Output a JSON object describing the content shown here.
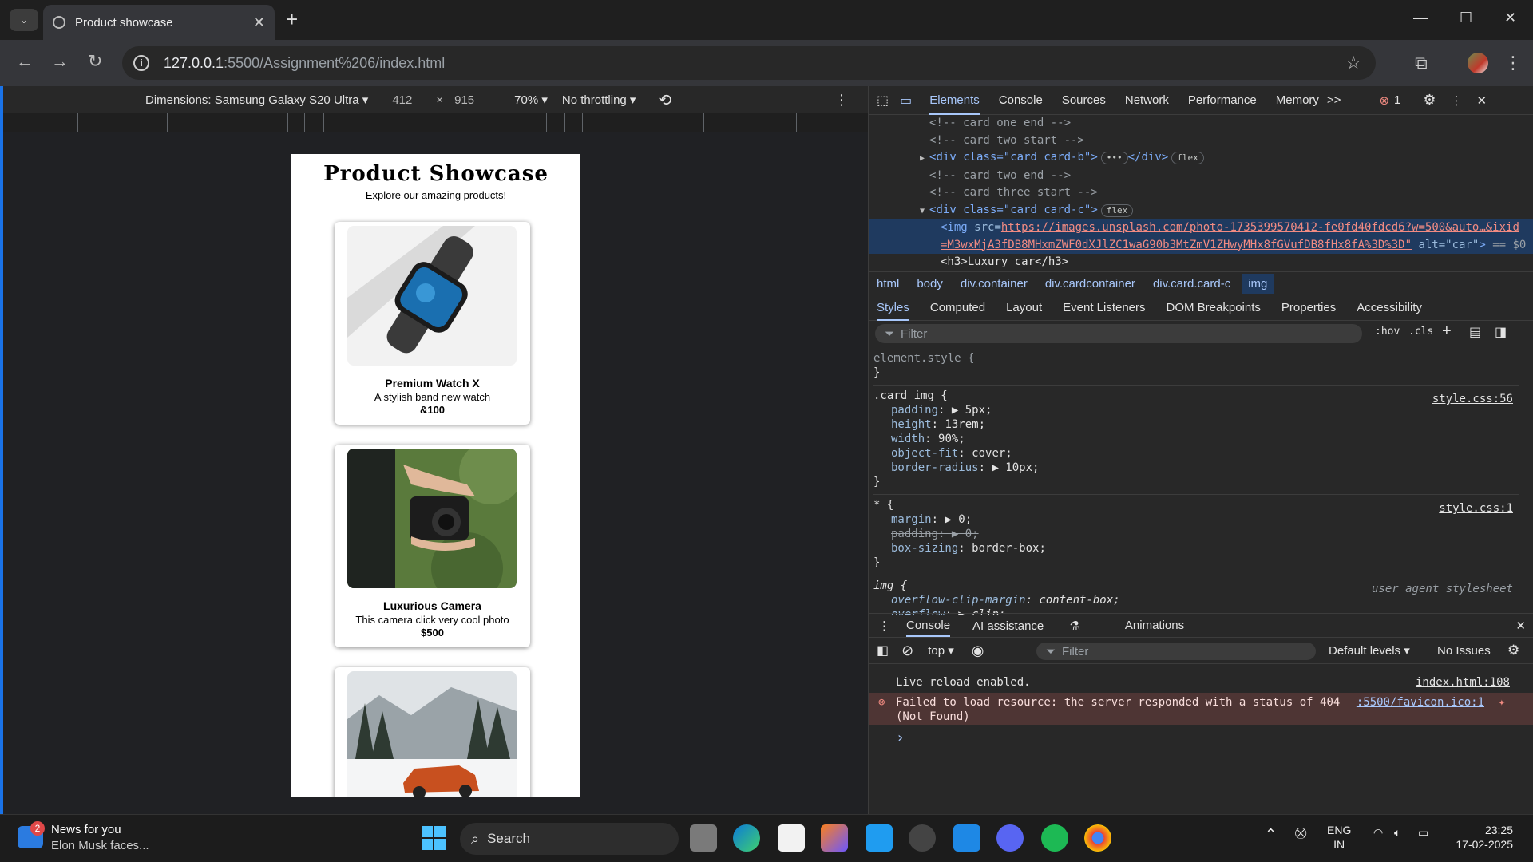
{
  "browser": {
    "tab_title": "Product showcase",
    "tab_close": "✕",
    "new_tab": "+",
    "url_host": "127.0.0.1",
    "url_rest": ":5500/Assignment%206/index.html",
    "window_min": "—",
    "window_max": "☐",
    "window_close": "✕"
  },
  "device_toolbar": {
    "dimensions_label": "Dimensions: Samsung Galaxy S20 Ultra",
    "width": "412",
    "times": "×",
    "height": "915",
    "zoom": "70%",
    "throttling": "No throttling"
  },
  "page": {
    "title": "Product Showcase",
    "subtitle": "Explore our amazing products!",
    "cards": [
      {
        "name": "Premium Watch X",
        "desc": "A stylish band new watch",
        "price": "&100"
      },
      {
        "name": "Luxurious Camera",
        "desc": "This camera click very cool photo",
        "price": "$500"
      },
      {
        "name": "",
        "desc": "",
        "price": ""
      }
    ]
  },
  "devtools": {
    "tabs": [
      "Elements",
      "Console",
      "Sources",
      "Network",
      "Performance",
      "Memory"
    ],
    "more": ">>",
    "error_count": "1",
    "dom_lines": {
      "l1": "<!-- card one end -->",
      "l2": "<!-- card two start -->",
      "l3_open": "<div class=\"card card-b\">",
      "l3_ell": "•••",
      "l3_close": "</div>",
      "l4": "<!-- card two end -->",
      "l5": "<!-- card three start -->",
      "l6": "<div class=\"card card-c\">",
      "flex": "flex",
      "l7_attr": "src=",
      "l7_url": "https://images.unsplash.com/photo-1735399570412-fe0fd40fdcd6?w=500&auto…&ixid",
      "l8_url": "=M3wxMjA3fDB8MHxmZWF0dXJlZC1waG90b3MtZmV1ZHwyMHx8fGVufDB8fHx8fA%3D%3D\"",
      "l8_alt": "alt=\"car\"",
      "l8_eq": "== $0",
      "l9": "<h3>Luxury car</h3>"
    },
    "breadcrumbs": [
      "html",
      "body",
      "div.container",
      "div.cardcontainer",
      "div.card.card-c",
      "img"
    ],
    "style_tabs": [
      "Styles",
      "Computed",
      "Layout",
      "Event Listeners",
      "DOM Breakpoints",
      "Properties",
      "Accessibility"
    ],
    "filter_placeholder": "Filter",
    "hov": ":hov",
    "cls": ".cls",
    "rules": {
      "element_style": "element.style {",
      "close": "}",
      "card_img_sel": ".card img {",
      "card_img_src": "style.css:56",
      "card_img_props": [
        {
          "n": "padding",
          "v": "▶ 5px;"
        },
        {
          "n": "height",
          "v": "13rem;"
        },
        {
          "n": "width",
          "v": "90%;"
        },
        {
          "n": "object-fit",
          "v": "cover;"
        },
        {
          "n": "border-radius",
          "v": "▶ 10px;"
        }
      ],
      "star_sel": "* {",
      "star_src": "style.css:1",
      "star_props": [
        {
          "n": "margin",
          "v": "▶ 0;"
        },
        {
          "n": "padding",
          "v": "▶ 0;"
        },
        {
          "n": "box-sizing",
          "v": "border-box;"
        }
      ],
      "img_sel": "img {",
      "img_src": "user agent stylesheet",
      "img_props": [
        {
          "n": "overflow-clip-margin",
          "v": "content-box;"
        },
        {
          "n": "overflow",
          "v": "▶ clip;"
        }
      ]
    },
    "drawer_tabs": [
      "Console",
      "AI assistance",
      "Animations"
    ],
    "console_context": "top",
    "console_filter": "Filter",
    "default_levels": "Default levels",
    "no_issues": "No Issues",
    "messages": {
      "m1": "Live reload enabled.",
      "m1_src": "index.html:108",
      "m2": "Failed to load resource: the server responded with a status of 404",
      "m2b": "(Not Found)",
      "m2_src": ":5500/favicon.ico:1",
      "prompt": "›"
    }
  },
  "taskbar": {
    "news_badge": "2",
    "news_title": "News for you",
    "news_sub": "Elon Musk faces...",
    "search": "Search",
    "lang1": "ENG",
    "lang2": "IN",
    "time": "23:25",
    "date": "17-02-2025"
  },
  "colors": {
    "accent": "#a8c7fa",
    "devtools_bg": "#282828",
    "error_bg": "#4e3534"
  }
}
